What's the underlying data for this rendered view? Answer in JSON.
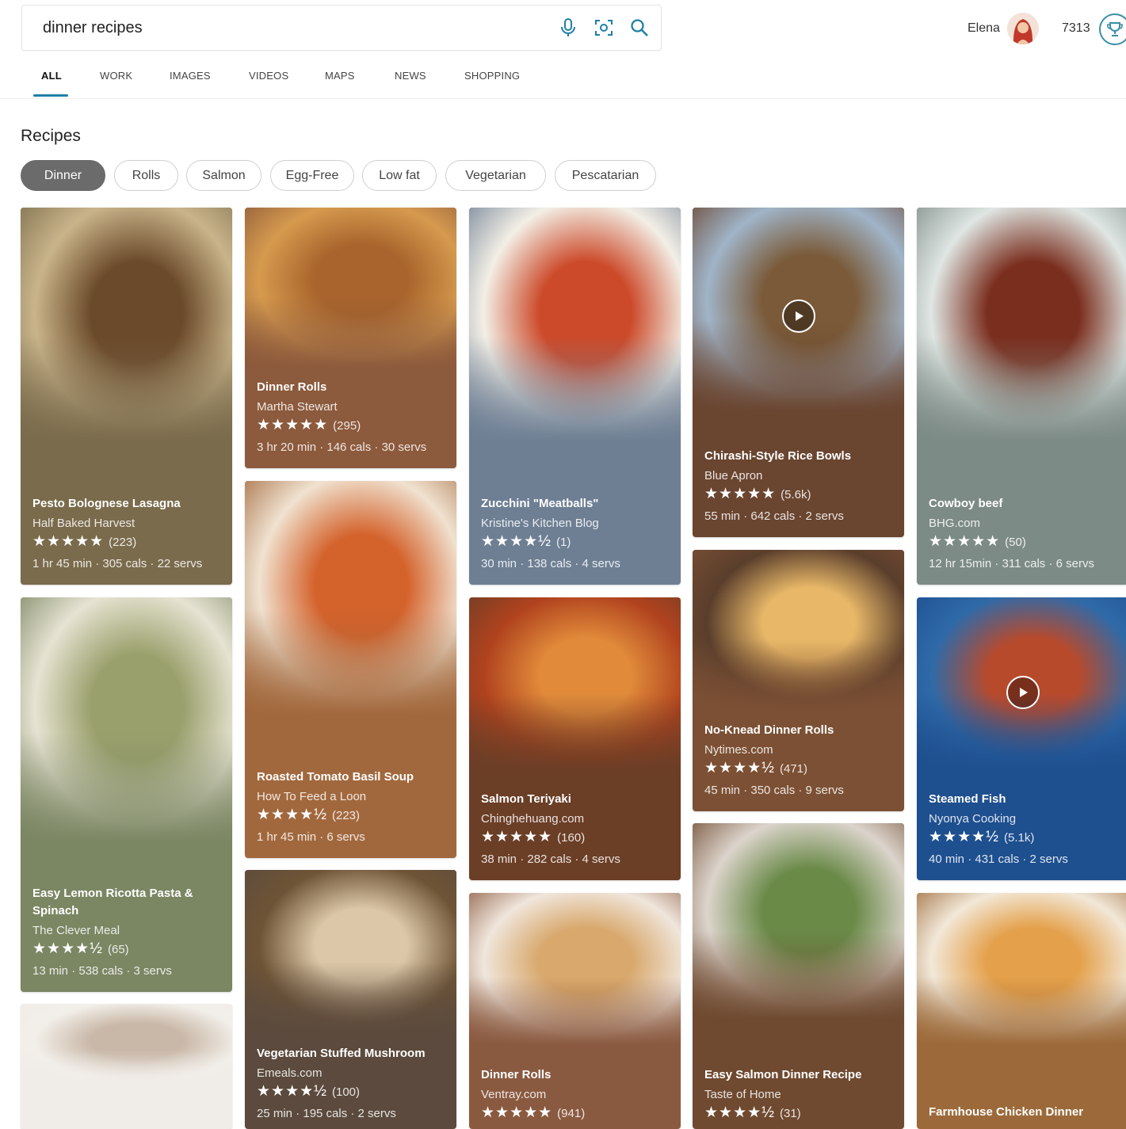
{
  "search": {
    "query": "dinner recipes"
  },
  "user": {
    "name": "Elena",
    "points": "7313"
  },
  "tabs": [
    {
      "label": "ALL"
    },
    {
      "label": "WORK"
    },
    {
      "label": "IMAGES"
    },
    {
      "label": "VIDEOS"
    },
    {
      "label": "MAPS"
    },
    {
      "label": "NEWS"
    },
    {
      "label": "SHOPPING"
    }
  ],
  "section": {
    "title": "Recipes"
  },
  "filters": [
    {
      "label": "Dinner"
    },
    {
      "label": "Rolls"
    },
    {
      "label": "Salmon"
    },
    {
      "label": "Egg-Free"
    },
    {
      "label": "Low fat"
    },
    {
      "label": "Vegetarian"
    },
    {
      "label": "Pescatarian"
    }
  ],
  "colors": {
    "accent": "#1f7fa6",
    "chip_active": "#6b6b6b"
  },
  "cards": [
    {
      "title": "Pesto Bolognese Lasagna",
      "source": "Half Baked Harvest",
      "stars": "★★★★★",
      "count": "(223)",
      "meta": "1 hr 45 min · 305 cals · 22 servs",
      "video": false
    },
    {
      "title": "Easy Lemon Ricotta Pasta & Spinach",
      "source": "The Clever Meal",
      "stars": "★★★★½",
      "count": "(65)",
      "meta": "13 min · 538 cals · 3 servs",
      "video": false
    },
    {
      "title": "",
      "source": "",
      "stars": "",
      "count": "",
      "meta": "",
      "video": false
    },
    {
      "title": "Dinner Rolls",
      "source": "Martha Stewart",
      "stars": "★★★★★",
      "count": "(295)",
      "meta": "3 hr 20 min · 146 cals · 30 servs",
      "video": false
    },
    {
      "title": "Roasted Tomato Basil Soup",
      "source": "How To Feed a Loon",
      "stars": "★★★★½",
      "count": "(223)",
      "meta": "1 hr 45 min · 6 servs",
      "video": false
    },
    {
      "title": "Vegetarian Stuffed Mushroom",
      "source": "Emeals.com",
      "stars": "★★★★½",
      "count": "(100)",
      "meta": "25 min · 195 cals · 2 servs",
      "video": false
    },
    {
      "title": "Zucchini \"Meatballs\"",
      "source": "Kristine's Kitchen Blog",
      "stars": "★★★★½",
      "count": "(1)",
      "meta": "30 min · 138 cals · 4 servs",
      "video": false
    },
    {
      "title": "Salmon Teriyaki",
      "source": "Chinghehuang.com",
      "stars": "★★★★★",
      "count": "(160)",
      "meta": "38 min · 282 cals · 4 servs",
      "video": false
    },
    {
      "title": "Dinner Rolls",
      "source": "Ventray.com",
      "stars": "★★★★★",
      "count": "(941)",
      "meta": "",
      "video": false
    },
    {
      "title": "Chirashi-Style Rice Bowls",
      "source": "Blue Apron",
      "stars": "★★★★★",
      "count": "(5.6k)",
      "meta": "55 min · 642 cals · 2 servs",
      "video": true
    },
    {
      "title": "No-Knead Dinner Rolls",
      "source": "Nytimes.com",
      "stars": "★★★★½",
      "count": "(471)",
      "meta": "45 min · 350 cals · 9 servs",
      "video": false
    },
    {
      "title": "Easy Salmon Dinner Recipe",
      "source": "Taste of Home",
      "stars": "★★★★½",
      "count": "(31)",
      "meta": "",
      "video": false
    },
    {
      "title": "Cowboy beef",
      "source": "BHG.com",
      "stars": "★★★★★",
      "count": "(50)",
      "meta": "12 hr 15min · 311 cals · 6 servs",
      "video": false
    },
    {
      "title": "Steamed Fish",
      "source": "Nyonya Cooking",
      "stars": "★★★★½",
      "count": "(5.1k)",
      "meta": "40 min · 431 cals · 2 servs",
      "video": true
    },
    {
      "title": "Farmhouse Chicken Dinner",
      "source": "",
      "stars": "",
      "count": "",
      "meta": "",
      "video": false
    }
  ]
}
